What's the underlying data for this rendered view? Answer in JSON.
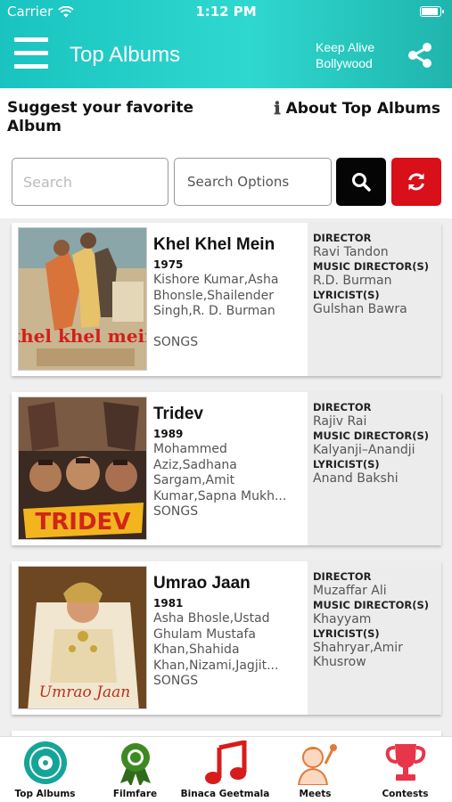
{
  "status_bar": {
    "carrier": "Carrier",
    "time": "1:12 PM"
  },
  "header": {
    "title": "Top Albums",
    "brand_line1": "Keep Alive",
    "brand_line2": "Bollywood"
  },
  "links": {
    "suggest": "Suggest your favorite Album",
    "about": "About Top Albums"
  },
  "search": {
    "placeholder": "Search",
    "value": "",
    "options_label": "Search Options"
  },
  "credit_labels": {
    "director": "DIRECTOR",
    "music_director": "MUSIC DIRECTOR(S)",
    "lyricist": "LYRICIST(S)"
  },
  "albums": [
    {
      "title": "Khel Khel Mein",
      "year": "1975",
      "artists": "Kishore Kumar,Asha Bhonsle,Shailender Singh,R. D. Burman",
      "songs": "SONGS",
      "poster_text": "khel khel mein",
      "director": "Ravi Tandon",
      "music_director": "R.D. Burman",
      "lyricist": "Gulshan Bawra"
    },
    {
      "title": "Tridev",
      "year": "1989",
      "artists": "Mohammed Aziz,Sadhana Sargam,Amit Kumar,Sapna Mukh...",
      "songs": "SONGS",
      "poster_text": "TRIDEV",
      "director": "Rajiv Rai",
      "music_director": "Kalyanji–Anandji",
      "lyricist": "Anand Bakshi"
    },
    {
      "title": "Umrao Jaan",
      "year": "1981",
      "artists": "Asha Bhosle,Ustad Ghulam Mustafa Khan,Shahida Khan,Nizami,Jagjit...",
      "songs": "SONGS",
      "poster_text": "Umrao Jaan",
      "director": "Muzaffar Ali",
      "music_director": "Khayyam",
      "lyricist": "Shahryar,Amir Khusrow"
    }
  ],
  "tabs": [
    {
      "label": "Top Albums",
      "icon": "vinyl-record-icon"
    },
    {
      "label": "Filmfare",
      "icon": "award-ribbon-icon"
    },
    {
      "label": "Binaca Geetmala",
      "icon": "music-note-icon"
    },
    {
      "label": "Meets",
      "icon": "singer-icon"
    },
    {
      "label": "Contests",
      "icon": "trophy-icon"
    }
  ],
  "colors": {
    "header_gradient_start": "#19c3c0",
    "header_gradient_end": "#1fb5ad",
    "search_button": "#050505",
    "refresh_button": "#d90f19",
    "credits_panel": "#ececec"
  }
}
